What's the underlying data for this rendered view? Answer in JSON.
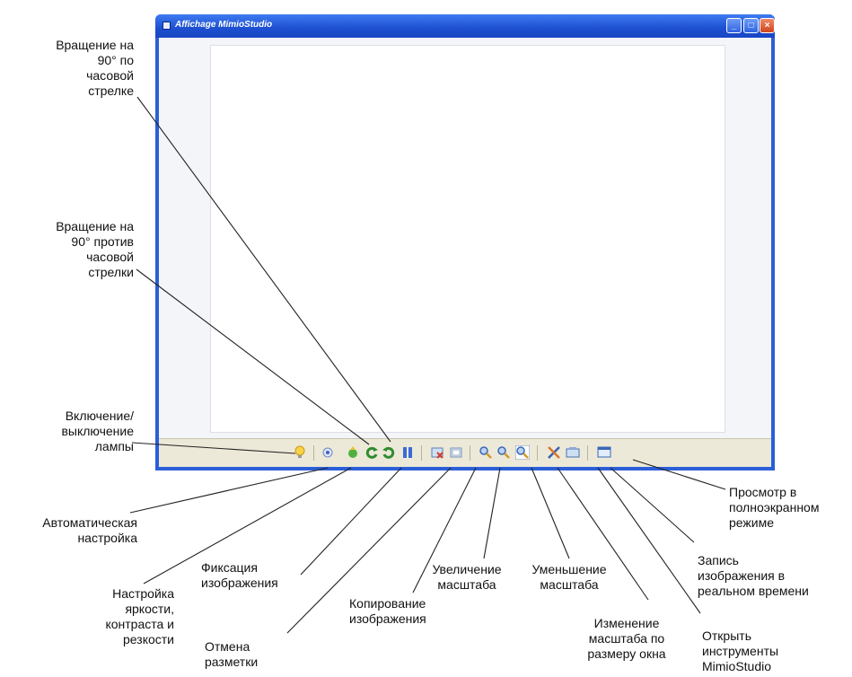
{
  "window": {
    "title": "Affichage MimioStudio"
  },
  "toolbar": {
    "icons": [
      "lamp-icon",
      "auto-adjust-icon",
      "brightness-icon",
      "rotate-cw-icon",
      "rotate-ccw-icon",
      "freeze-icon",
      "copy-image-icon",
      "clear-markup-icon",
      "zoom-in-icon",
      "zoom-out-icon",
      "zoom-fit-icon",
      "mimio-tools-icon",
      "record-icon",
      "fullscreen-icon"
    ]
  },
  "labels": {
    "rotate_cw": "Вращение на\n90° по\nчасовой\nстрелке",
    "rotate_ccw": "Вращение на\n90° против\nчасовой\nстрелки",
    "lamp": "Включение/\nвыключение\nлампы",
    "auto": "Автоматическая\nнастройка",
    "brightness": "Настройка\nяркости,\nконтраста и\nрезкости",
    "freeze": "Фиксация\nизображения",
    "clear": "Отмена\nразметки",
    "copy": "Копирование\nизображения",
    "zoom_in": "Увеличение\nмасштаба",
    "zoom_out": "Уменьшение\nмасштаба",
    "zoom_fit": "Изменение\nмасштаба по\nразмеру окна",
    "tools": "Открыть\nинструменты\nMimioStudio",
    "record": "Запись\nизображения в\nреальном времени",
    "fullscreen": "Просмотр в\nполноэкранном\nрежиме"
  }
}
